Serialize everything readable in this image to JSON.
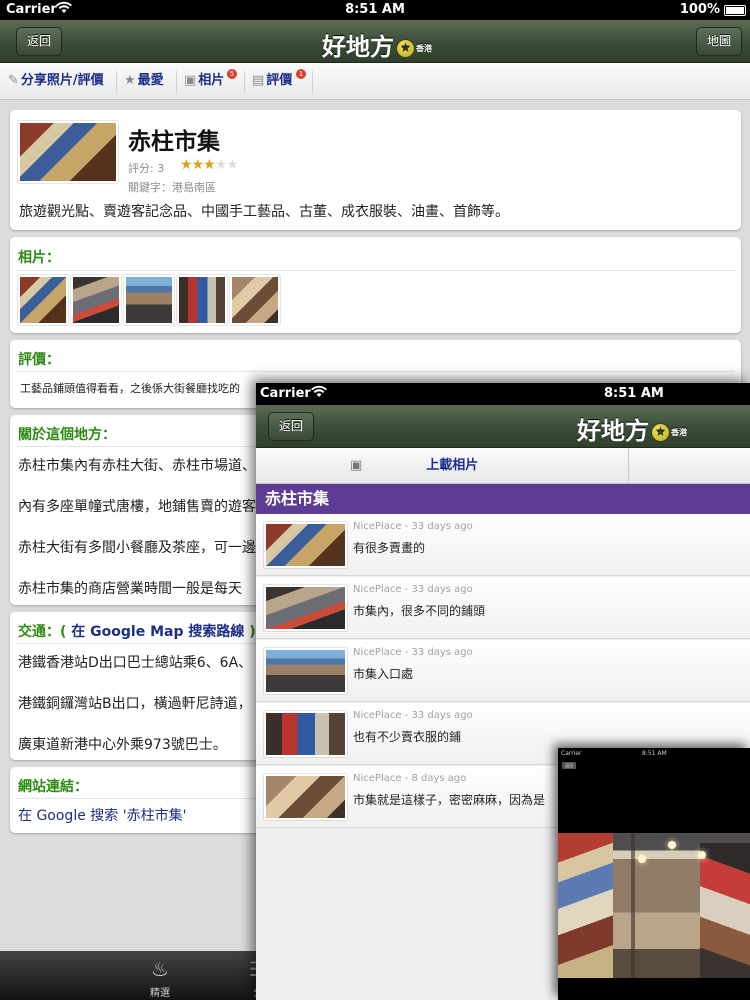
{
  "status_bar": {
    "carrier": "Carrier",
    "time": "8:51 AM",
    "battery": "100%"
  },
  "nav": {
    "back_label": "返回",
    "title": "好地方",
    "title_sub": "香港",
    "map_label": "地圖"
  },
  "toolbar": {
    "share_label": "分享照片/評價",
    "favorite_label": "最愛",
    "photos_label": "相片",
    "photos_badge": "5",
    "reviews_label": "評價",
    "reviews_badge": "1"
  },
  "place": {
    "name": "赤柱市集",
    "rating_label": "評分: 3",
    "rating": 3,
    "rating_max": 5,
    "keywords": "關鍵字：港島南區",
    "description": "旅遊觀光點、賣遊客記念品、中國手工藝品、古董、成衣服裝、油畫、首飾等。"
  },
  "photos_section": {
    "title": "相片："
  },
  "reviews_section": {
    "title": "評價：",
    "snippet": "工藝品鋪頭值得看看，之後係大街餐廳找吃的"
  },
  "about_section": {
    "title": "關於這個地方：",
    "paragraphs": [
      "赤柱市集內有赤柱大街、赤柱市場道、",
      "內有多座單幢式唐樓，地鋪售賣的遊客",
      "赤柱大街有多間小餐廳及茶座，可一邊",
      "赤柱市集的商店營業時間一般是每天"
    ]
  },
  "transport_section": {
    "title_prefix": "交通：( ",
    "title_link": "在 Google Map 搜索路線",
    "title_suffix": " )",
    "lines": [
      "港鐵香港站D出口巴士總站乘6、6A、",
      "港鐵銅鑼灣站B出口，橫過軒尼詩道，",
      "廣東道新港中心外乘973號巴士。"
    ]
  },
  "links_section": {
    "title": "網站連結：",
    "link": "在 Google 搜索 '赤柱市集'"
  },
  "tabbar": {
    "items": [
      {
        "label": "精選",
        "icon": "flame-icon"
      },
      {
        "label": "分",
        "icon": "list-icon"
      }
    ]
  },
  "overlay1": {
    "status": {
      "carrier": "Carrier",
      "time": "8:51 AM"
    },
    "nav": {
      "back_label": "返回",
      "title": "好地方",
      "title_sub": "香港"
    },
    "upload_label": "上載相片",
    "header": "赤柱市集",
    "reviews": [
      {
        "meta": "NicePlace - 33 days ago",
        "text": "有很多賣畫的"
      },
      {
        "meta": "NicePlace - 33 days ago",
        "text": "市集內，很多不同的鋪頭"
      },
      {
        "meta": "NicePlace - 33 days ago",
        "text": "市集入口處"
      },
      {
        "meta": "NicePlace - 33 days ago",
        "text": "也有不少賣衣服的鋪"
      },
      {
        "meta": "NicePlace - 8 days ago",
        "text": "市集就是這樣子，密密麻麻，因為是"
      }
    ]
  },
  "overlay2": {
    "status_time": "8:51 AM",
    "status_carrier": "Carrier",
    "back_label": "返回"
  },
  "colors": {
    "nav_green": "#3a4c35",
    "section_green": "#2e8b14",
    "link_blue": "#1b2f8a",
    "purple": "#5d3c94",
    "badge_red": "#e23b2c",
    "star": "#d9a21b"
  }
}
